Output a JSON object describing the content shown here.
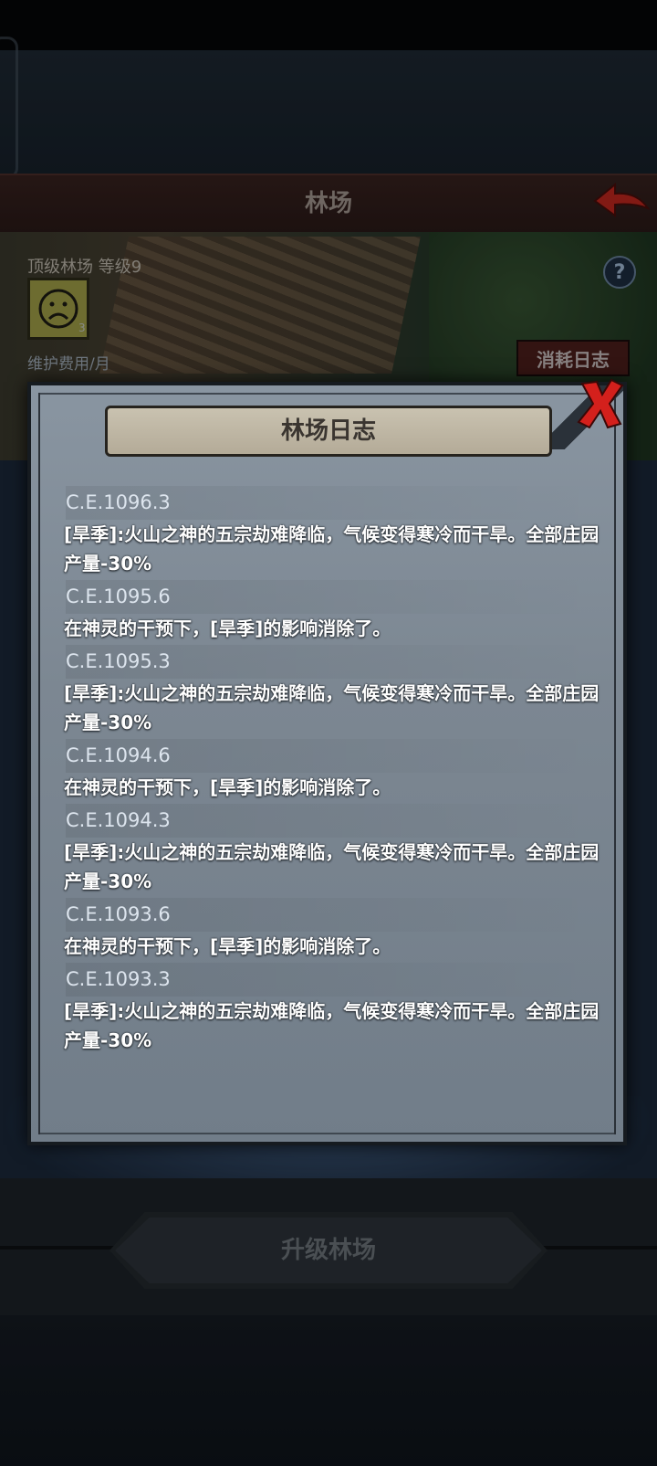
{
  "header": {
    "title": "林场"
  },
  "farm": {
    "level_text": "顶级林场 等级9",
    "mood_count": "3",
    "fee_label": "维护费用/月",
    "consume_log_label": "消耗日志",
    "help_symbol": "?"
  },
  "modal": {
    "title": "林场日志",
    "entries": [
      {
        "date": "C.E.1096.3",
        "text": "[旱季]:火山之神的五宗劫难降临，气候变得寒冷而干旱。全部庄园产量-30%"
      },
      {
        "date": "C.E.1095.6",
        "text": "在神灵的干预下，[旱季]的影响消除了。"
      },
      {
        "date": "C.E.1095.3",
        "text": "[旱季]:火山之神的五宗劫难降临，气候变得寒冷而干旱。全部庄园产量-30%"
      },
      {
        "date": "C.E.1094.6",
        "text": "在神灵的干预下，[旱季]的影响消除了。"
      },
      {
        "date": "C.E.1094.3",
        "text": "[旱季]:火山之神的五宗劫难降临，气候变得寒冷而干旱。全部庄园产量-30%"
      },
      {
        "date": "C.E.1093.6",
        "text": "在神灵的干预下，[旱季]的影响消除了。"
      },
      {
        "date": "C.E.1093.3",
        "text": "[旱季]:火山之神的五宗劫难降临，气候变得寒冷而干旱。全部庄园产量-30%"
      }
    ]
  },
  "footer": {
    "upgrade_label": "升级林场"
  },
  "icons": {
    "back": "back-arrow-icon",
    "close": "close-icon",
    "help": "help-icon",
    "mood": "sad-face-icon"
  },
  "colors": {
    "title_bar": "#3a2320",
    "close_red": "#d4201c",
    "modal_bg": "#7c8792"
  }
}
